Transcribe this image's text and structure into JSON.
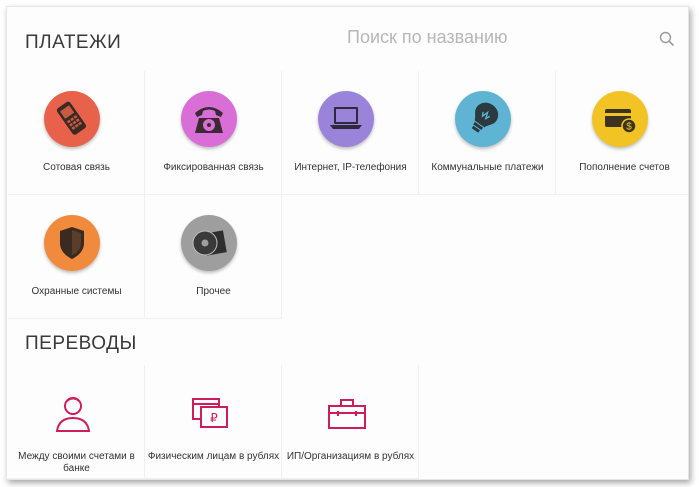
{
  "payments": {
    "title": "ПЛАТЕЖИ",
    "search_placeholder": "Поиск по названию",
    "items": [
      {
        "label": "Сотовая связь",
        "icon": "mobile-phone-icon",
        "color": "#e8614a"
      },
      {
        "label": "Фиксированная связь",
        "icon": "landline-phone-icon",
        "color": "#d96fd6"
      },
      {
        "label": "Интернет, IP-телефония",
        "icon": "laptop-icon",
        "color": "#9a84da"
      },
      {
        "label": "Коммунальные платежи",
        "icon": "lightbulb-icon",
        "color": "#5fb4d4"
      },
      {
        "label": "Пополнение счетов",
        "icon": "wallet-card-icon",
        "color": "#f1c324"
      },
      {
        "label": "Охранные системы",
        "icon": "shield-icon",
        "color": "#f08a3c"
      },
      {
        "label": "Прочее",
        "icon": "disc-icon",
        "color": "#9e9e9e"
      }
    ]
  },
  "transfers": {
    "title": "ПЕРЕВОДЫ",
    "accent": "#cc1f5a",
    "items": [
      {
        "label": "Между своими счетами в банке",
        "icon": "person-icon"
      },
      {
        "label": "Физическим лицам в рублях",
        "icon": "ruble-transfer-icon"
      },
      {
        "label": "ИП/Организациям в рублях",
        "icon": "briefcase-icon"
      }
    ]
  }
}
